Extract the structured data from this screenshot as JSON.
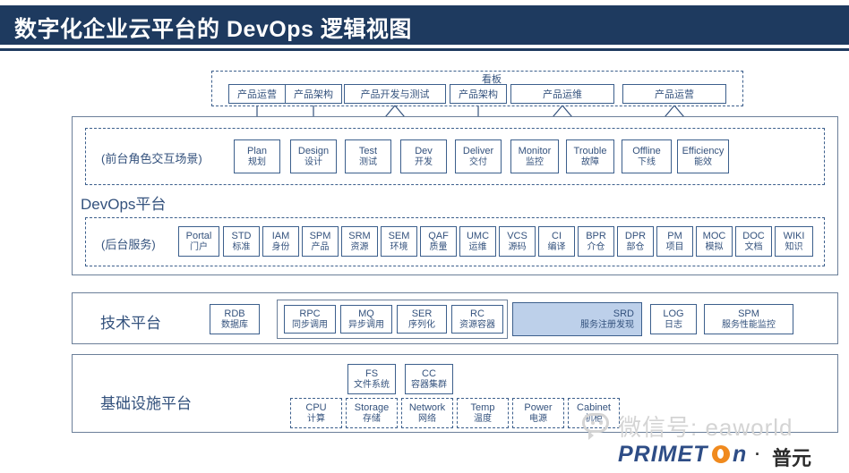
{
  "title": "数字化企业云平台的 DevOps 逻辑视图",
  "kanban_label": "看板",
  "roles": [
    {
      "label": "产品运营"
    },
    {
      "label": "产品架构"
    },
    {
      "label": "产品开发与测试"
    },
    {
      "label": "产品架构"
    },
    {
      "label": "产品运维"
    },
    {
      "label": "产品运营"
    }
  ],
  "devops_panel": {
    "title": "DevOps平台",
    "frontstage_label": "(前台角色交互场景)",
    "backstage_label": "(后台服务)",
    "stages": [
      {
        "en": "Plan",
        "cn": "规划"
      },
      {
        "en": "Design",
        "cn": "设计"
      },
      {
        "en": "Test",
        "cn": "测试"
      },
      {
        "en": "Dev",
        "cn": "开发"
      },
      {
        "en": "Deliver",
        "cn": "交付"
      },
      {
        "en": "Monitor",
        "cn": "监控"
      },
      {
        "en": "Trouble",
        "cn": "故障"
      },
      {
        "en": "Offline",
        "cn": "下线"
      },
      {
        "en": "Efficiency",
        "cn": "能效"
      }
    ],
    "services": [
      {
        "en": "Portal",
        "cn": "门户"
      },
      {
        "en": "STD",
        "cn": "标准"
      },
      {
        "en": "IAM",
        "cn": "身份"
      },
      {
        "en": "SPM",
        "cn": "产品"
      },
      {
        "en": "SRM",
        "cn": "资源"
      },
      {
        "en": "SEM",
        "cn": "环境"
      },
      {
        "en": "QAF",
        "cn": "质量"
      },
      {
        "en": "UMC",
        "cn": "运维"
      },
      {
        "en": "VCS",
        "cn": "源码"
      },
      {
        "en": "CI",
        "cn": "编译"
      },
      {
        "en": "BPR",
        "cn": "介仓"
      },
      {
        "en": "DPR",
        "cn": "部仓"
      },
      {
        "en": "PM",
        "cn": "项目"
      },
      {
        "en": "MOC",
        "cn": "模拟"
      },
      {
        "en": "DOC",
        "cn": "文档"
      },
      {
        "en": "WIKI",
        "cn": "知识"
      }
    ]
  },
  "tech_panel": {
    "title": "技术平台",
    "rdb": {
      "en": "RDB",
      "cn": "数据库"
    },
    "group": [
      {
        "en": "RPC",
        "cn": "同步调用"
      },
      {
        "en": "MQ",
        "cn": "异步调用"
      },
      {
        "en": "SER",
        "cn": "序列化"
      },
      {
        "en": "RC",
        "cn": "资源容器"
      }
    ],
    "srd": {
      "en": "SRD",
      "cn": "服务注册发现",
      "highlight_color": "#bdd0ea"
    },
    "tail": [
      {
        "en": "LOG",
        "cn": "日志"
      },
      {
        "en": "SPM",
        "cn": "服务性能监控"
      }
    ]
  },
  "infra_panel": {
    "title": "基础设施平台",
    "upper": [
      {
        "en": "FS",
        "cn": "文件系统"
      },
      {
        "en": "CC",
        "cn": "容器集群"
      }
    ],
    "lower": [
      {
        "en": "CPU",
        "cn": "计算"
      },
      {
        "en": "Storage",
        "cn": "存储"
      },
      {
        "en": "Network",
        "cn": "网络"
      },
      {
        "en": "Temp",
        "cn": "温度"
      },
      {
        "en": "Power",
        "cn": "电源"
      },
      {
        "en": "Cabinet",
        "cn": "机柜"
      }
    ]
  },
  "watermark": {
    "text": "微信号: eaworld"
  },
  "logo": {
    "brand": "PRIMET",
    "brand_tail": "n",
    "separator": "·",
    "cn": "普元"
  }
}
